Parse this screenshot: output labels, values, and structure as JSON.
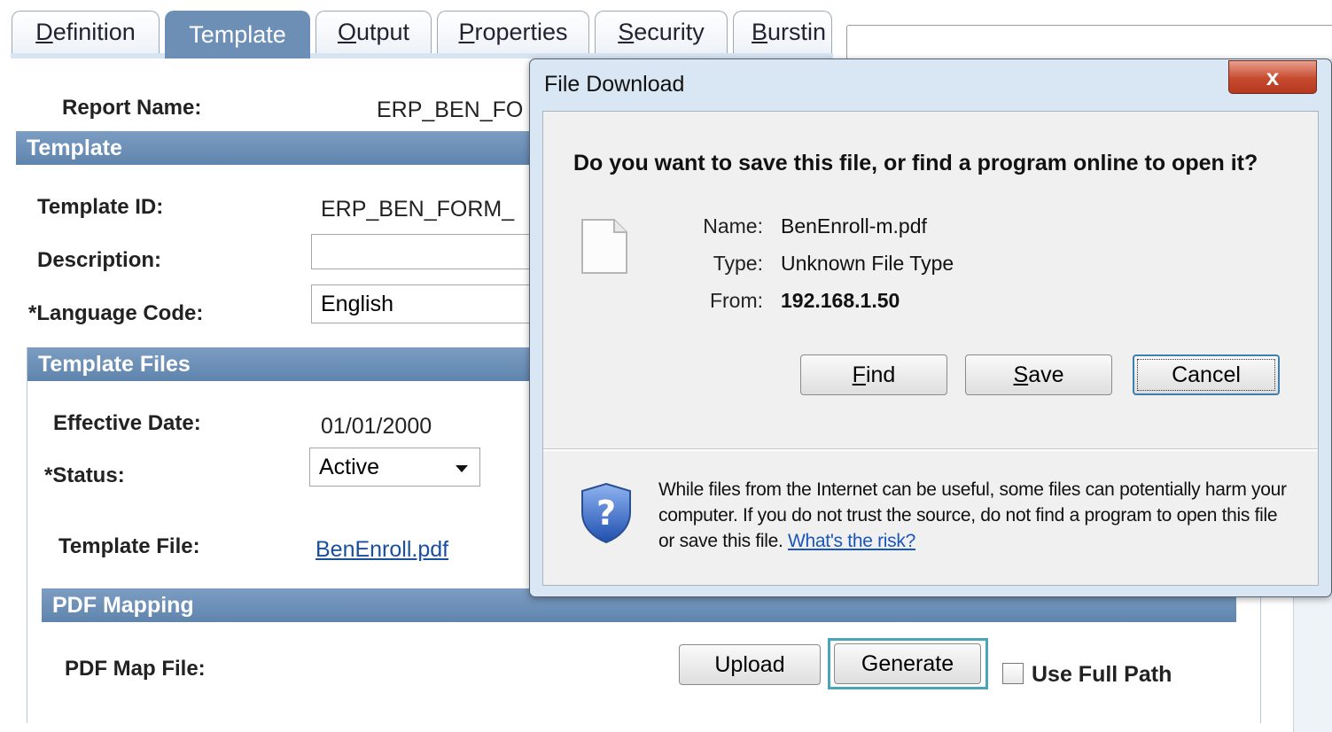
{
  "tabs": [
    {
      "label": "Definition",
      "underline": "D",
      "rest": "efinition",
      "active": false
    },
    {
      "label": "Template",
      "active": true
    },
    {
      "label": "Output",
      "underline": "O",
      "rest": "utput",
      "active": false
    },
    {
      "label": "Properties",
      "underline": "P",
      "rest": "roperties",
      "active": false
    },
    {
      "label": "Security",
      "underline": "S",
      "rest": "ecurity",
      "active": false
    },
    {
      "label": "Burstin",
      "underline": "B",
      "rest": "urstin",
      "active": false
    }
  ],
  "report": {
    "name_label": "Report Name:",
    "name_value": "ERP_BEN_FO"
  },
  "template_section": {
    "title": "Template",
    "template_id_label": "Template ID:",
    "template_id_value": "ERP_BEN_FORM_",
    "description_label": "Description:",
    "description_value": "",
    "language_label": "*Language Code:",
    "language_value": "English"
  },
  "template_files": {
    "title": "Template Files",
    "effective_date_label": "Effective Date:",
    "effective_date_value": "01/01/2000",
    "status_label": "*Status:",
    "status_value": "Active",
    "template_file_label": "Template File:",
    "template_file_value": "BenEnroll.pdf"
  },
  "pdf_mapping": {
    "title": "PDF Mapping",
    "map_file_label": "PDF Map File:",
    "upload_label": "Upload",
    "generate_label": "Generate",
    "use_full_path_label": "Use Full Path"
  },
  "dialog": {
    "title": "File Download",
    "close_glyph": "x",
    "question": "Do you want to save this file, or find a program online to open it?",
    "name_label": "Name:",
    "name_value": "BenEnroll-m.pdf",
    "type_label": "Type:",
    "type_value": "Unknown File Type",
    "from_label": "From:",
    "from_value": "192.168.1.50",
    "find_u": "F",
    "find_rest": "ind",
    "save_u": "S",
    "save_rest": "ave",
    "cancel_label": "Cancel",
    "warning_text": "While files from the Internet can be useful, some files can potentially harm your computer. If you do not trust the source, do not find a program to open this file or save this file. ",
    "risk_link": "What's the risk?"
  },
  "icons": {
    "file": "file-icon",
    "shield": "shield-question-icon",
    "dropdown": "dropdown-arrow-icon",
    "close": "close-icon"
  },
  "colors": {
    "active_tab": "#6d8fb5",
    "section_bar": "#6e90b8",
    "dialog_frame": "#d9e6f4",
    "close_button": "#c64a2e",
    "link": "#1a4fa0",
    "focus_ring": "#4aa5b8"
  }
}
